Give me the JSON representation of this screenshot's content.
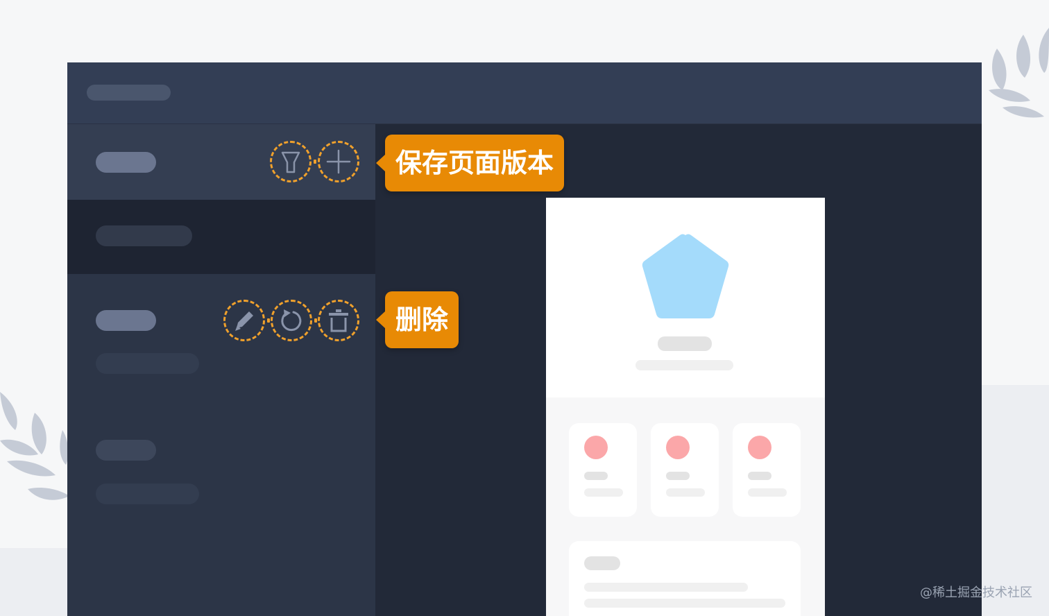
{
  "callouts": {
    "save_version": "保存页面版本",
    "delete": "删除"
  },
  "icons": {
    "header_actions": [
      "filter-icon",
      "plus-icon"
    ],
    "item_actions": [
      "edit-pencil-icon",
      "revert-icon",
      "trash-icon"
    ]
  },
  "colors": {
    "accent": "#e88a05",
    "dashed_ring": "#f0a12c",
    "app_bg": "#222938",
    "topbar": "#333e55",
    "sidebar": "#2c3547",
    "preview_shape": "#a4dbfb",
    "preview_dot": "#fba7a9"
  },
  "watermark": "@稀土掘金技术社区"
}
